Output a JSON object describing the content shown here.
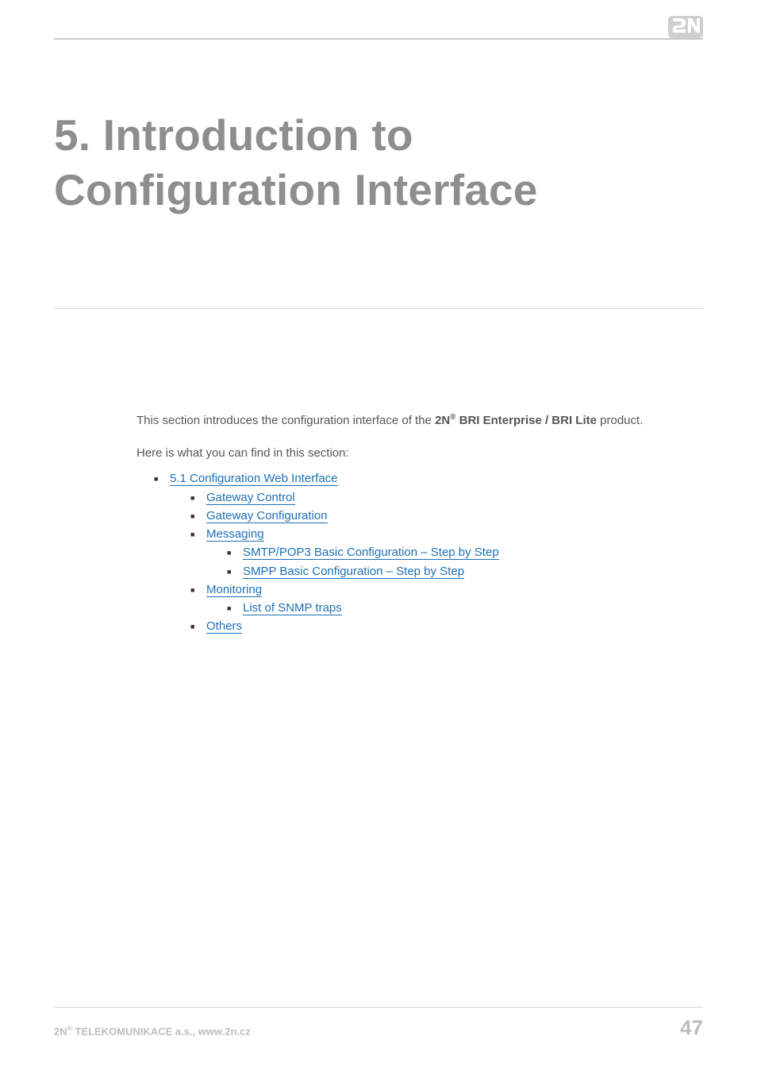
{
  "header": {
    "brand_label": "2N"
  },
  "title": "5. Introduction to Configuration Interface",
  "intro": {
    "prefix": "This section introduces the configuration interface of the ",
    "product_prefix_bold": "2N",
    "product_reg": "®",
    "product_suffix_bold": " BRI Enterprise / BRI Lite",
    "suffix": " product."
  },
  "find_text": "Here is what you can find in this section:",
  "toc": {
    "l1_1": "5.1 Configuration Web Interface",
    "l2_1": "Gateway Control",
    "l2_2": "Gateway Configuration",
    "l2_3": "Messaging",
    "l3_1": "SMTP/POP3 Basic Configuration – Step by Step",
    "l3_2": "SMPP Basic Configuration – Step by Step",
    "l2_4": "Monitoring",
    "l3_3": "List of SNMP traps",
    "l2_5": "Others"
  },
  "footer": {
    "company_prefix": "2N",
    "company_reg": "®",
    "company_suffix": " TELEKOMUNIKACE a.s., www.2n.cz",
    "page_number": "47"
  }
}
